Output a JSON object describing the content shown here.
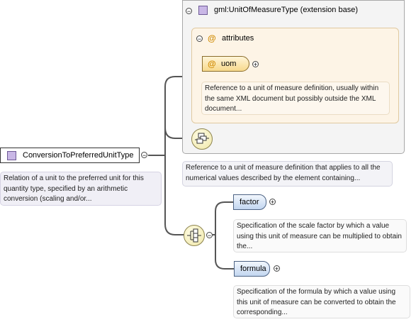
{
  "extension_base": {
    "type_name": "gml:UnitOfMeasureType (extension base)",
    "collapse_symbol": "−",
    "attributes_group": {
      "label": "attributes",
      "at_symbol": "@",
      "collapse_symbol": "−",
      "attribute": {
        "name": "uom",
        "at_symbol": "@",
        "expand_symbol": "+",
        "documentation": "Reference to a unit of measure definition, usually within the same XML document but possibly outside the XML document..."
      }
    },
    "documentation": "Reference to a unit of measure definition that applies to all the numerical values described by the element containing..."
  },
  "element": {
    "name": "ConversionToPreferredUnitType",
    "collapse_symbol": "−",
    "documentation": "Relation of a unit to the preferred unit for this quantity type, specified by an arithmetic conversion (scaling and/or..."
  },
  "choice": {
    "collapse_symbol": "−",
    "children": [
      {
        "name": "factor",
        "expand_symbol": "+",
        "documentation": "Specification of the scale factor by which a value using this unit of measure can be multiplied to obtain the..."
      },
      {
        "name": "formula",
        "expand_symbol": "+",
        "documentation": "Specification of the formula by which a value using this unit of measure can be converted to obtain the corresponding..."
      }
    ]
  }
}
